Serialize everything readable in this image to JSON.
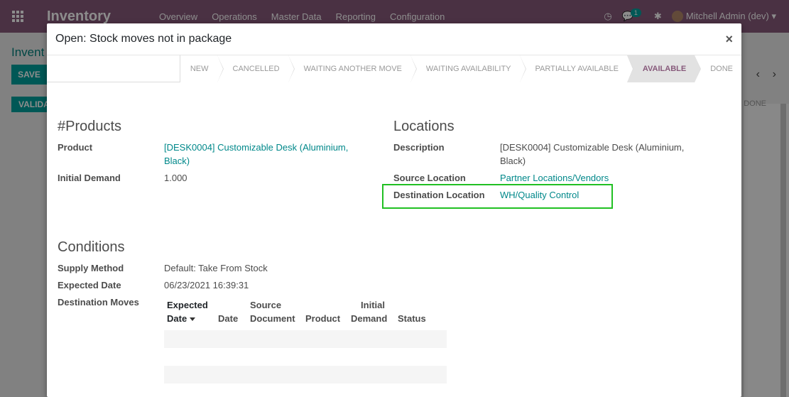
{
  "navbar": {
    "app_name": "Inventory",
    "menu": [
      "Overview",
      "Operations",
      "Master Data",
      "Reporting",
      "Configuration"
    ],
    "message_count": "1",
    "user": "Mitchell Admin (dev)"
  },
  "background": {
    "title": "Invent",
    "save_label": "SAVE",
    "validate_label": "VALIDA",
    "pager_prev": "‹",
    "pager_next": "›",
    "done_label": "DONE"
  },
  "modal": {
    "title": "Open: Stock moves not in package",
    "close": "×"
  },
  "statusbar": {
    "stages": [
      "NEW",
      "CANCELLED",
      "WAITING ANOTHER MOVE",
      "WAITING AVAILABILITY",
      "PARTIALLY AVAILABLE",
      "AVAILABLE",
      "DONE"
    ],
    "active": "AVAILABLE"
  },
  "products": {
    "title": "#Products",
    "product_label": "Product",
    "product_value_line1": "[DESK0004] Customizable Desk (Aluminium,",
    "product_value_line2": "Black)",
    "initial_demand_label": "Initial Demand",
    "initial_demand_value": "1.000"
  },
  "locations": {
    "title": "Locations",
    "description_label": "Description",
    "description_line1": "[DESK0004] Customizable Desk (Aluminium,",
    "description_line2": "Black)",
    "source_label": "Source Location",
    "source_value": "Partner Locations/Vendors",
    "destination_label": "Destination Location",
    "destination_value": "WH/Quality Control"
  },
  "conditions": {
    "title": "Conditions",
    "supply_label": "Supply Method",
    "supply_value": "Default: Take From Stock",
    "expected_label": "Expected Date",
    "expected_value": "06/23/2021 16:39:31",
    "dest_moves_label": "Destination Moves"
  },
  "dest_moves_table": {
    "col_expected_l1": "Expected",
    "col_expected_l2": "Date",
    "col_date": "Date",
    "col_source_l1": "Source",
    "col_source_l2": "Document",
    "col_product": "Product",
    "col_initial_l1": "Initial",
    "col_initial_l2": "Demand",
    "col_status": "Status"
  },
  "colors": {
    "brand": "#875a7b",
    "link": "#00888a",
    "highlight": "#21c023"
  }
}
